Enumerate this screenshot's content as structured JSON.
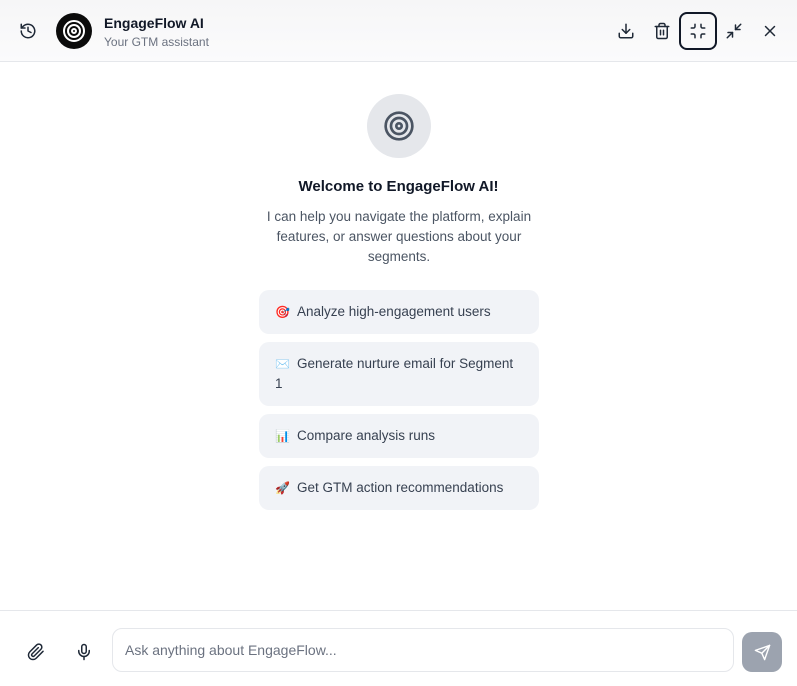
{
  "header": {
    "title": "EngageFlow AI",
    "subtitle": "Your GTM assistant",
    "icons": [
      "history-icon",
      "target-icon",
      "download-icon",
      "trash-icon",
      "collapse-icon",
      "minimize-icon",
      "close-icon"
    ]
  },
  "welcome": {
    "title": "Welcome to EngageFlow AI!",
    "body": "I can help you navigate the platform, explain features, or answer questions about your segments."
  },
  "suggestions": [
    {
      "emoji": "🎯",
      "label": "Analyze high-engagement users"
    },
    {
      "emoji": "✉️",
      "label": "Generate nurture email for Segment 1"
    },
    {
      "emoji": "📊",
      "label": "Compare analysis runs"
    },
    {
      "emoji": "🚀",
      "label": "Get GTM action recommendations"
    }
  ],
  "composer": {
    "placeholder": "Ask anything about EngageFlow...",
    "value": "",
    "icons": [
      "paperclip-icon",
      "microphone-icon",
      "send-icon"
    ]
  },
  "colors": {
    "avatar_bg": "#0b0b0b",
    "suggestion_bg": "#f1f3f7",
    "send_button_bg": "#9ca3af",
    "hero_icon_bg": "#e5e7eb"
  }
}
